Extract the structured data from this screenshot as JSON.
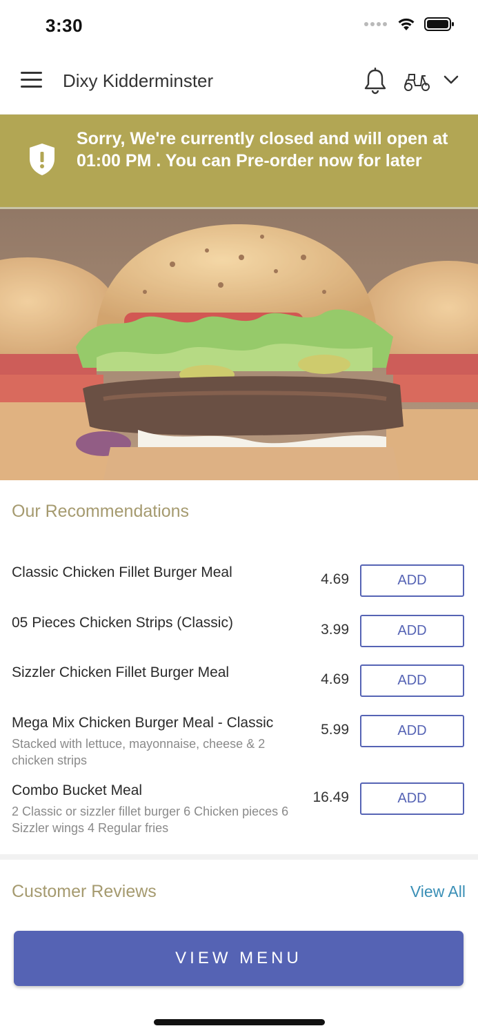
{
  "status_bar": {
    "time": "3:30"
  },
  "header": {
    "title": "Dixy Kidderminster"
  },
  "banner": {
    "message": "Sorry, We're currently closed and will open at 01:00 PM . You can Pre-order now for later"
  },
  "recommendations": {
    "title": "Our Recommendations",
    "items": [
      {
        "name": "Classic Chicken Fillet Burger Meal",
        "description": "",
        "price": "4.69",
        "button": "ADD"
      },
      {
        "name": "05 Pieces Chicken Strips (Classic)",
        "description": "",
        "price": "3.99",
        "button": "ADD"
      },
      {
        "name": "Sizzler Chicken Fillet Burger Meal",
        "description": "",
        "price": "4.69",
        "button": "ADD"
      },
      {
        "name": "Mega Mix Chicken Burger Meal - Classic",
        "description": "Stacked with lettuce, mayonnaise, cheese & 2 chicken strips",
        "price": "5.99",
        "button": "ADD"
      },
      {
        "name": "Combo Bucket Meal",
        "description": "2 Classic or sizzler fillet burger  6 Chicken pieces  6 Sizzler wings  4 Regular fries",
        "price": "16.49",
        "button": "ADD"
      }
    ]
  },
  "reviews": {
    "title": "Customer Reviews",
    "view_all": "View All"
  },
  "footer": {
    "view_menu": "VIEW MENU"
  },
  "icons": [
    "wifi-icon",
    "battery-icon",
    "hamburger-menu-icon",
    "bell-icon",
    "scooter-icon",
    "chevron-down-icon",
    "shield-alert-icon"
  ],
  "colors": {
    "banner": "#b2a654",
    "accent": "#5563b4",
    "section_title": "#a59a6f",
    "link": "#3a8fb6"
  }
}
